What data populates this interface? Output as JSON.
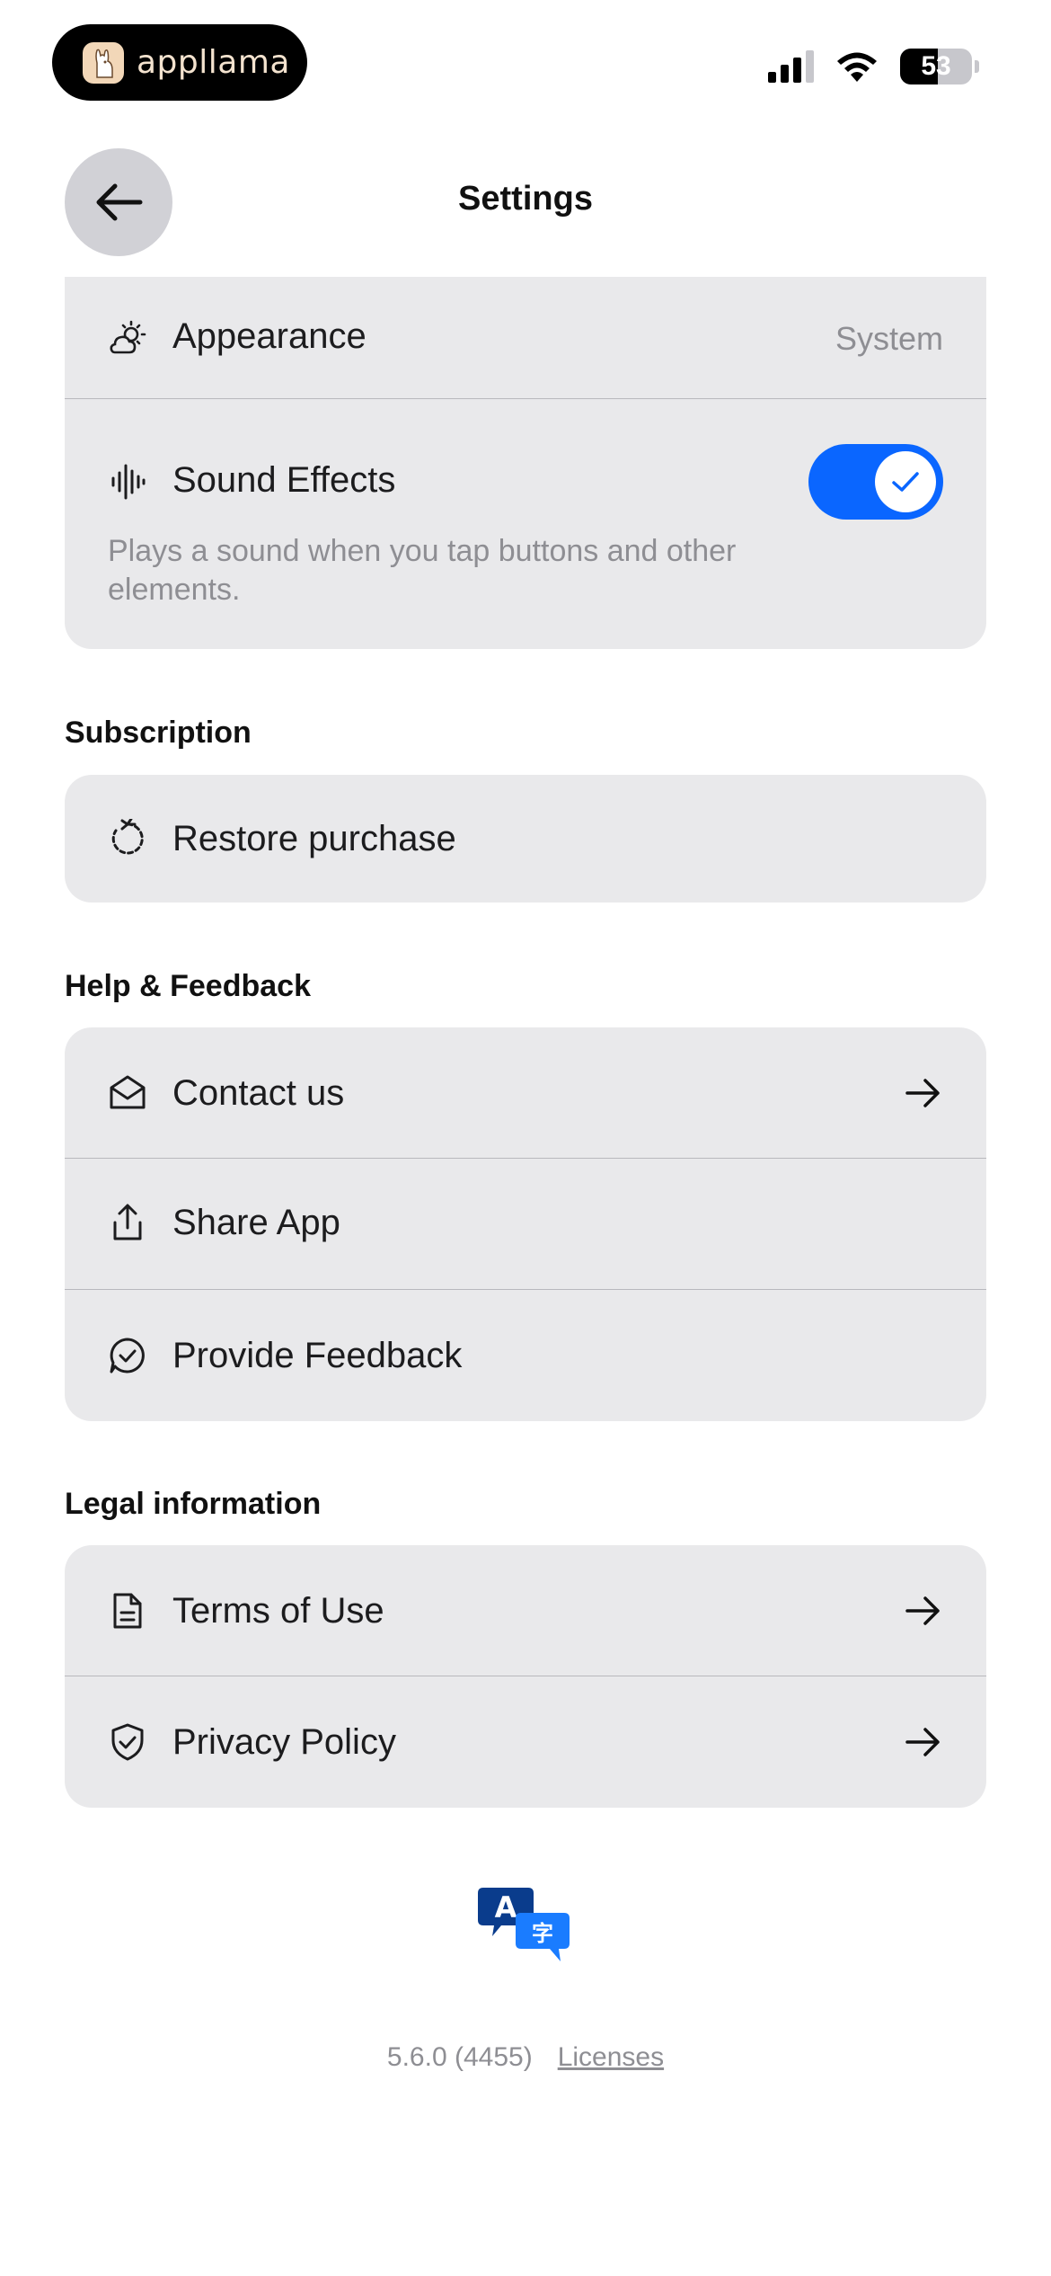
{
  "status_bar": {
    "brand": "appllama",
    "battery": "53"
  },
  "header": {
    "title": "Settings"
  },
  "general": {
    "appearance": {
      "label": "Appearance",
      "value": "System"
    },
    "sound_effects": {
      "label": "Sound Effects",
      "description": "Plays a sound when you tap buttons and other elements.",
      "enabled": true
    }
  },
  "subscription": {
    "title": "Subscription",
    "items": [
      {
        "label": "Restore purchase",
        "icon": "restore-icon"
      }
    ]
  },
  "help": {
    "title": "Help & Feedback",
    "items": [
      {
        "label": "Contact us",
        "icon": "mail-open-icon"
      },
      {
        "label": "Share App",
        "icon": "share-icon"
      },
      {
        "label": "Provide Feedback",
        "icon": "chat-check-icon"
      }
    ]
  },
  "legal": {
    "title": "Legal information",
    "items": [
      {
        "label": "Terms of Use",
        "icon": "document-icon"
      },
      {
        "label": "Privacy Policy",
        "icon": "shield-check-icon"
      }
    ]
  },
  "footer": {
    "version": "5.6.0 (4455)",
    "licenses": "Licenses"
  },
  "colors": {
    "accent": "#0a66ff",
    "card": "#e9e9eb",
    "secondary_text": "#8e8e93"
  }
}
